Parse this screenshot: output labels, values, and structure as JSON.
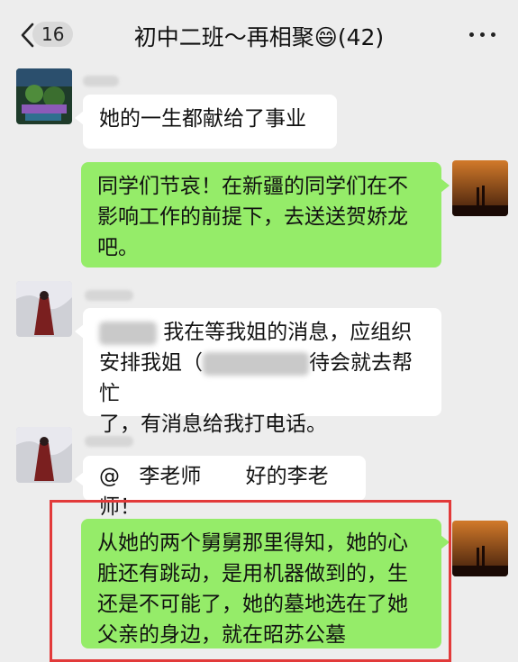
{
  "header": {
    "back_label": "<",
    "unread_count": "16",
    "title": "初中二班～再相聚😄(42)",
    "more_icon": "more-dots-icon"
  },
  "messages": [
    {
      "side": "left",
      "text": "她的一生都献给了事业"
    },
    {
      "side": "right",
      "text_lines": [
        "同学们节哀！在新疆的同学们在不",
        "影响工作的前提下，去送送贺娇龙",
        "吧。"
      ]
    },
    {
      "side": "left",
      "line1_after_redaction": " 我在等我姐的消息，应组织",
      "line2_before_redaction": "安排我姐（",
      "line2_after_redaction": "待会就去帮忙",
      "line3": "了，有消息给我打电话。"
    },
    {
      "side": "left",
      "mention": "@",
      "mention_name": "李老师",
      "reply": "好的李老师！"
    },
    {
      "side": "right",
      "text_lines": [
        "从她的两个舅舅那里得知，她的心",
        "脏还有跳动，是用机器做到的，生",
        "还是不可能了，她的墓地选在了她",
        "父亲的身边，就在昭苏公墓"
      ]
    }
  ],
  "colors": {
    "background": "#ededed",
    "green_bubble": "#95ec69",
    "white_bubble": "#ffffff",
    "highlight": "#e23a3a"
  }
}
